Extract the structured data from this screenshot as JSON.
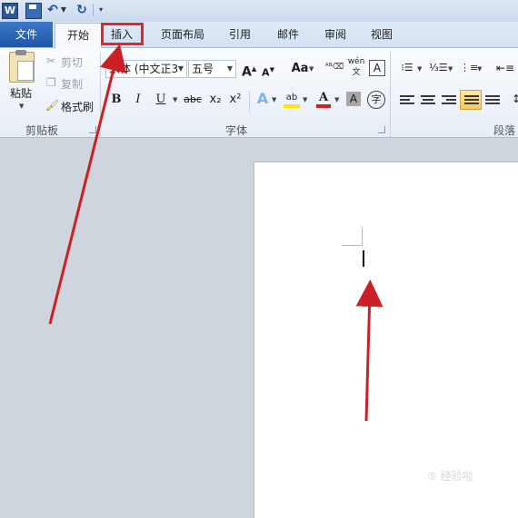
{
  "quick_access": {
    "word_logo": "W",
    "icons": [
      "word-logo-icon",
      "save-icon",
      "undo-icon",
      "undo-dropdown-icon",
      "redo-icon",
      "customize-dropdown-icon"
    ]
  },
  "tabs": [
    {
      "label": "文件",
      "state": "file"
    },
    {
      "label": "开始",
      "state": "active"
    },
    {
      "label": "插入",
      "state": "highlighted"
    },
    {
      "label": "页面布局",
      "state": "normal"
    },
    {
      "label": "引用",
      "state": "normal"
    },
    {
      "label": "邮件",
      "state": "normal"
    },
    {
      "label": "审阅",
      "state": "normal"
    },
    {
      "label": "视图",
      "state": "normal"
    }
  ],
  "clipboard": {
    "paste_label": "粘贴",
    "cut_label": "剪切",
    "copy_label": "复制",
    "format_painter_label": "格式刷",
    "group_label": "剪贴板"
  },
  "font": {
    "font_name": "宋体 (中文正3",
    "font_size": "五号",
    "grow_label": "A",
    "shrink_label": "A",
    "change_case_label": "Aa",
    "phonetic_label": "wén",
    "bold": "B",
    "italic": "I",
    "underline": "U",
    "strike": "abc",
    "subscript": "x₂",
    "superscript": "x²",
    "text_effect": "A",
    "highlight": "ab",
    "font_color": "A",
    "char_shading": "A",
    "enclose": "字",
    "group_label": "字体"
  },
  "paragraph": {
    "group_label": "段落"
  },
  "watermark": "⑤ 经验啦",
  "colors": {
    "file_tab": "#2a62b8",
    "highlight_box": "#e0282a",
    "arrow": "#cc1f26",
    "highlight_yellow": "#ffe600",
    "font_red": "#e01b1b"
  }
}
